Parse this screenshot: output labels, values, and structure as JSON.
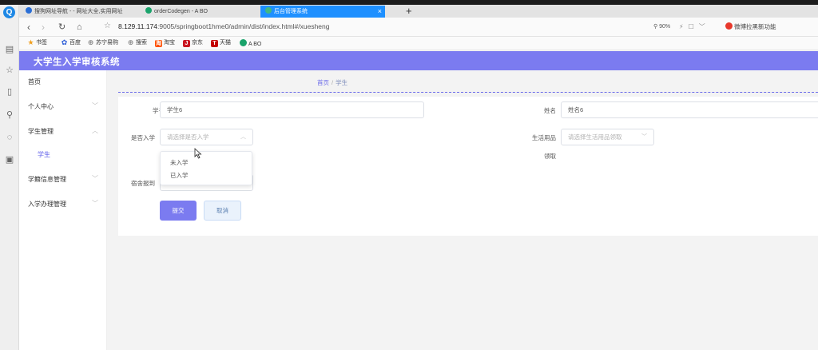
{
  "browser": {
    "logo": "Q",
    "tabs": [
      {
        "label": "搜狗网址导航 - - 网址大全,实用网址",
        "color": "#2b6fd6"
      },
      {
        "label": "orderCodegen - A BO",
        "color": "#1aa36b"
      },
      {
        "label": "后台管理系统",
        "color": "#42b883",
        "active": true
      }
    ],
    "tab_close": "×",
    "new_tab": "+",
    "url_host": "8.129.11.174",
    "url_path": ":9005/springboot1hme0/admin/dist/index.html#/xuesheng",
    "zoom": "90%",
    "weibo": "微博拉黑新功能",
    "bookmarks": [
      {
        "label": "书签",
        "icon": "star-icon",
        "color": "#f0a020"
      },
      {
        "label": "百度",
        "icon": "baidu-icon",
        "color": "#2a5bd7"
      },
      {
        "label": "苏宁易购",
        "icon": "globe-icon",
        "color": "#888888"
      },
      {
        "label": "搜索",
        "icon": "globe-icon",
        "color": "#888888"
      },
      {
        "label": "淘宝",
        "icon": "taobao-icon",
        "color": "#ff5000"
      },
      {
        "label": "京东",
        "icon": "jd-icon",
        "color": "#c91623"
      },
      {
        "label": "天猫",
        "icon": "tmall-icon",
        "color": "#c40000"
      },
      {
        "label": "A BO",
        "icon": "abo-icon",
        "color": "#1aa36b"
      }
    ]
  },
  "app": {
    "title": "大学生入学审核系统",
    "accent": "#7b7bf0"
  },
  "sidebar": {
    "items": [
      {
        "label": "首页"
      },
      {
        "label": "个人中心",
        "chevron": "﹀"
      },
      {
        "label": "学生管理",
        "chevron": "︿"
      },
      {
        "label": "学生"
      },
      {
        "label": "学籍信息管理",
        "chevron": "﹀"
      },
      {
        "label": "入学办理管理",
        "chevron": "﹀"
      }
    ]
  },
  "breadcrumb": {
    "home": "首页",
    "sep": "/",
    "current": "学生"
  },
  "form": {
    "student_no_label": "学号",
    "student_no_value": "学生6",
    "name_label": "姓名",
    "name_value": "姓名6",
    "enrolled_label": "是否入学",
    "enrolled_placeholder": "请选择是否入学",
    "enrolled_options": [
      "未入学",
      "已入学"
    ],
    "supplies_label": "生活用品",
    "supplies_label2": "领取",
    "supplies_placeholder": "请选择生活用品领取",
    "dorm_label": "宿舍报到",
    "submit_label": "提交",
    "cancel_label": "取消"
  }
}
